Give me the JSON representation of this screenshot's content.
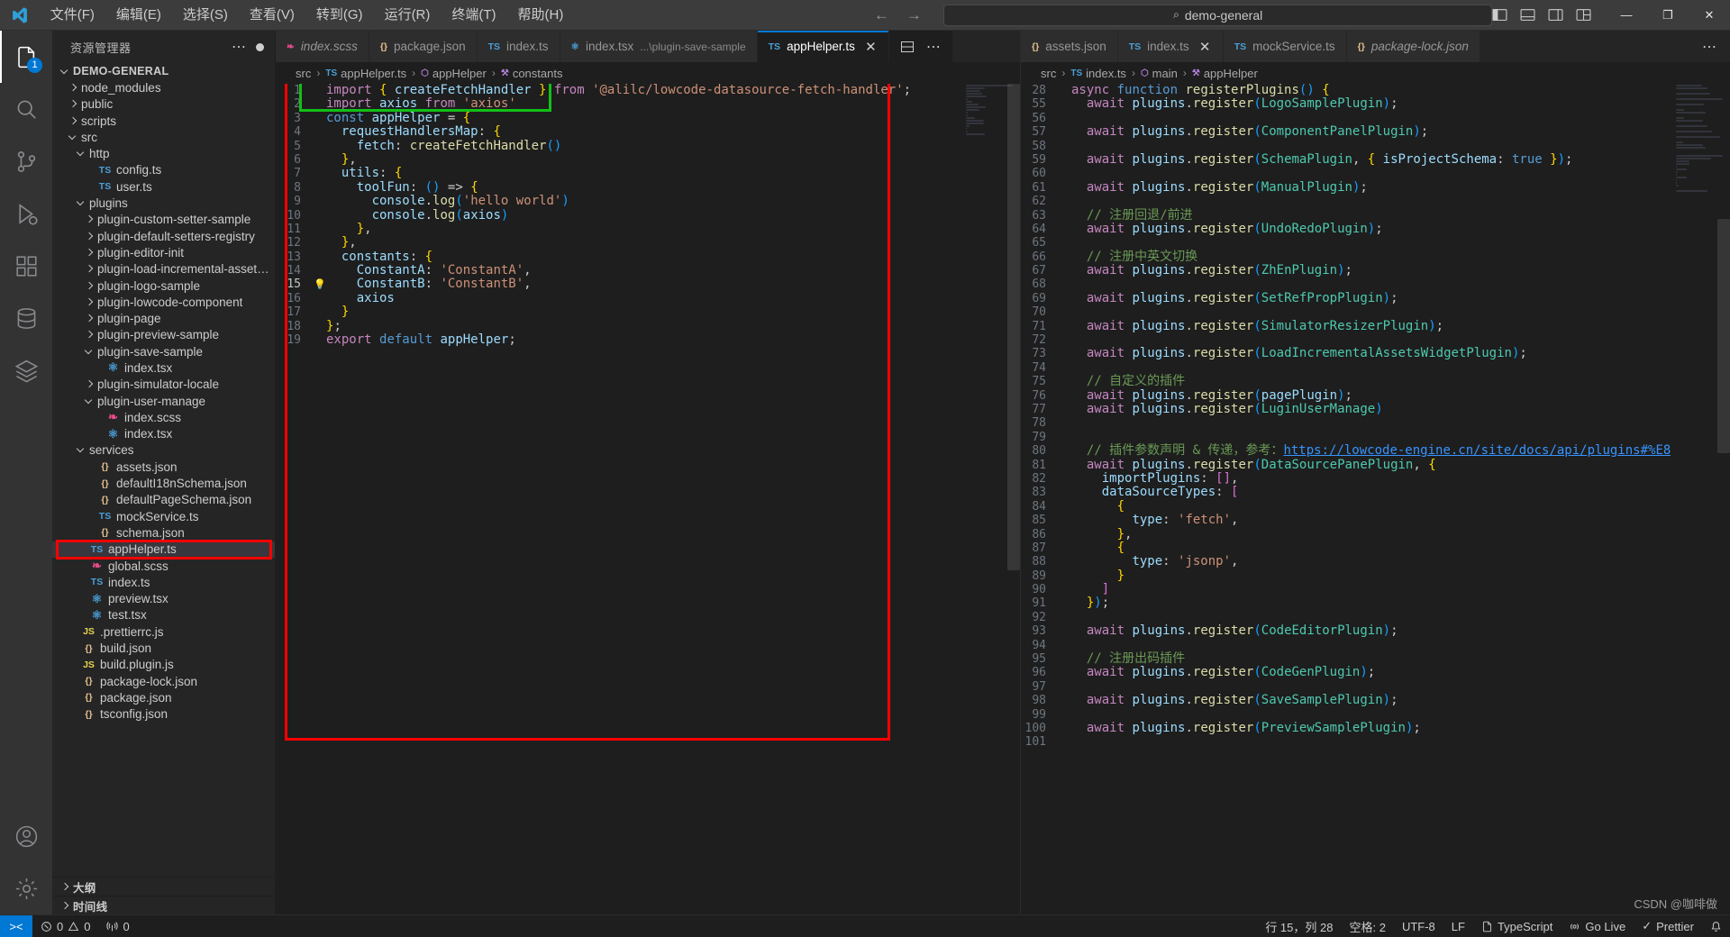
{
  "titlebar": {
    "menus": [
      "文件(F)",
      "编辑(E)",
      "选择(S)",
      "查看(V)",
      "转到(G)",
      "运行(R)",
      "终端(T)",
      "帮助(H)"
    ],
    "back_arrow": "←",
    "forward_arrow": "→",
    "quick_open": "demo-general",
    "search_glyph": "⌕",
    "minimize": "—",
    "maximize": "❐",
    "close": "✕"
  },
  "activitybar": {
    "items": [
      {
        "name": "explorer",
        "badge": ""
      },
      {
        "name": "search",
        "badge": ""
      },
      {
        "name": "source-control",
        "badge": ""
      },
      {
        "name": "run-and-debug",
        "badge": ""
      },
      {
        "name": "extensions",
        "badge": ""
      },
      {
        "name": "database",
        "badge": ""
      },
      {
        "name": "layers",
        "badge": ""
      }
    ],
    "bottom": [
      "accounts",
      "settings"
    ]
  },
  "sidebar": {
    "title": "资源管理器",
    "more_glyph": "⋯",
    "root": "DEMO-GENERAL",
    "sections": [
      "大纲",
      "时间线"
    ],
    "tree": [
      {
        "label": "DEMO-GENERAL",
        "depth": 0,
        "type": "root",
        "state": "open"
      },
      {
        "label": "node_modules",
        "depth": 1,
        "type": "folder",
        "state": "closed"
      },
      {
        "label": "public",
        "depth": 1,
        "type": "folder",
        "state": "closed"
      },
      {
        "label": "scripts",
        "depth": 1,
        "type": "folder",
        "state": "closed"
      },
      {
        "label": "src",
        "depth": 1,
        "type": "folder",
        "state": "open"
      },
      {
        "label": "http",
        "depth": 2,
        "type": "folder",
        "state": "open"
      },
      {
        "label": "config.ts",
        "depth": 3,
        "type": "ts"
      },
      {
        "label": "user.ts",
        "depth": 3,
        "type": "ts"
      },
      {
        "label": "plugins",
        "depth": 2,
        "type": "folder",
        "state": "open"
      },
      {
        "label": "plugin-custom-setter-sample",
        "depth": 3,
        "type": "folder",
        "state": "closed"
      },
      {
        "label": "plugin-default-setters-registry",
        "depth": 3,
        "type": "folder",
        "state": "closed"
      },
      {
        "label": "plugin-editor-init",
        "depth": 3,
        "type": "folder",
        "state": "closed"
      },
      {
        "label": "plugin-load-incremental-assets-w...",
        "depth": 3,
        "type": "folder",
        "state": "closed"
      },
      {
        "label": "plugin-logo-sample",
        "depth": 3,
        "type": "folder",
        "state": "closed"
      },
      {
        "label": "plugin-lowcode-component",
        "depth": 3,
        "type": "folder",
        "state": "closed"
      },
      {
        "label": "plugin-page",
        "depth": 3,
        "type": "folder",
        "state": "closed"
      },
      {
        "label": "plugin-preview-sample",
        "depth": 3,
        "type": "folder",
        "state": "closed"
      },
      {
        "label": "plugin-save-sample",
        "depth": 3,
        "type": "folder",
        "state": "open"
      },
      {
        "label": "index.tsx",
        "depth": 4,
        "type": "tsx"
      },
      {
        "label": "plugin-simulator-locale",
        "depth": 3,
        "type": "folder",
        "state": "closed"
      },
      {
        "label": "plugin-user-manage",
        "depth": 3,
        "type": "folder",
        "state": "open"
      },
      {
        "label": "index.scss",
        "depth": 4,
        "type": "scss"
      },
      {
        "label": "index.tsx",
        "depth": 4,
        "type": "tsx"
      },
      {
        "label": "services",
        "depth": 2,
        "type": "folder",
        "state": "open"
      },
      {
        "label": "assets.json",
        "depth": 3,
        "type": "json"
      },
      {
        "label": "defaultI18nSchema.json",
        "depth": 3,
        "type": "json"
      },
      {
        "label": "defaultPageSchema.json",
        "depth": 3,
        "type": "json"
      },
      {
        "label": "mockService.ts",
        "depth": 3,
        "type": "ts"
      },
      {
        "label": "schema.json",
        "depth": 3,
        "type": "json"
      },
      {
        "label": "appHelper.ts",
        "depth": 2,
        "type": "ts",
        "selected": true,
        "highlight": "red"
      },
      {
        "label": "global.scss",
        "depth": 2,
        "type": "scss"
      },
      {
        "label": "index.ts",
        "depth": 2,
        "type": "ts"
      },
      {
        "label": "preview.tsx",
        "depth": 2,
        "type": "tsx"
      },
      {
        "label": "test.tsx",
        "depth": 2,
        "type": "tsx"
      },
      {
        "label": ".prettierrc.js",
        "depth": 1,
        "type": "js"
      },
      {
        "label": "build.json",
        "depth": 1,
        "type": "json"
      },
      {
        "label": "build.plugin.js",
        "depth": 1,
        "type": "js"
      },
      {
        "label": "package-lock.json",
        "depth": 1,
        "type": "json"
      },
      {
        "label": "package.json",
        "depth": 1,
        "type": "json"
      },
      {
        "label": "tsconfig.json",
        "depth": 1,
        "type": "json"
      }
    ]
  },
  "left_pane": {
    "tabs": [
      {
        "label": "index.scss",
        "icon": "scss",
        "preview": true,
        "active": false,
        "close": false
      },
      {
        "label": "package.json",
        "icon": "json",
        "preview": false,
        "active": false,
        "close": false
      },
      {
        "label": "index.ts",
        "icon": "ts",
        "preview": false,
        "active": false,
        "close": false
      },
      {
        "label": "index.tsx",
        "icon": "tsx",
        "sub": "...\\plugin-save-sample",
        "preview": false,
        "active": false,
        "close": false
      },
      {
        "label": "appHelper.ts",
        "icon": "ts",
        "preview": false,
        "active": true,
        "close": true
      }
    ],
    "breadcrumb": [
      "src",
      "appHelper.ts",
      "appHelper",
      "constants"
    ],
    "lines": [
      {
        "n": 1,
        "text": "import { createFetchHandler } from '@alilc/lowcode-datasource-fetch-handler';"
      },
      {
        "n": 2,
        "text": "import axios from 'axios'"
      },
      {
        "n": 3,
        "text": "const appHelper = {"
      },
      {
        "n": 4,
        "text": "  requestHandlersMap: {"
      },
      {
        "n": 5,
        "text": "    fetch: createFetchHandler()"
      },
      {
        "n": 6,
        "text": "  },"
      },
      {
        "n": 7,
        "text": "  utils: {"
      },
      {
        "n": 8,
        "text": "    toolFun: () => {"
      },
      {
        "n": 9,
        "text": "      console.log('hello world')"
      },
      {
        "n": 10,
        "text": "      console.log(axios)"
      },
      {
        "n": 11,
        "text": "    },"
      },
      {
        "n": 12,
        "text": "  },"
      },
      {
        "n": 13,
        "text": "  constants: {"
      },
      {
        "n": 14,
        "text": "    ConstantA: 'ConstantA',"
      },
      {
        "n": 15,
        "text": "    ConstantB: 'ConstantB',"
      },
      {
        "n": 16,
        "text": "    axios"
      },
      {
        "n": 17,
        "text": "  }"
      },
      {
        "n": 18,
        "text": "};"
      },
      {
        "n": 19,
        "text": "export default appHelper;"
      }
    ],
    "cursor_line": 15,
    "lightbulb_line": 15
  },
  "right_pane": {
    "tabs": [
      {
        "label": "assets.json",
        "icon": "json",
        "preview": false,
        "active": false,
        "close": false
      },
      {
        "label": "index.ts",
        "icon": "ts",
        "preview": false,
        "active": false,
        "close": true
      },
      {
        "label": "mockService.ts",
        "icon": "ts",
        "preview": false,
        "active": false,
        "close": false
      },
      {
        "label": "package-lock.json",
        "icon": "json",
        "preview": true,
        "active": false,
        "close": false
      }
    ],
    "more_glyph": "⋯",
    "breadcrumb": [
      "src",
      "index.ts",
      "main",
      "appHelper"
    ],
    "lines": [
      {
        "n": 28,
        "text": "async function registerPlugins() {"
      },
      {
        "n": 55,
        "text": "  await plugins.register(LogoSamplePlugin);"
      },
      {
        "n": 56,
        "text": ""
      },
      {
        "n": 57,
        "text": "  await plugins.register(ComponentPanelPlugin);"
      },
      {
        "n": 58,
        "text": ""
      },
      {
        "n": 59,
        "text": "  await plugins.register(SchemaPlugin, { isProjectSchema: true });"
      },
      {
        "n": 60,
        "text": ""
      },
      {
        "n": 61,
        "text": "  await plugins.register(ManualPlugin);"
      },
      {
        "n": 62,
        "text": ""
      },
      {
        "n": 63,
        "text": "  // 注册回退/前进"
      },
      {
        "n": 64,
        "text": "  await plugins.register(UndoRedoPlugin);"
      },
      {
        "n": 65,
        "text": ""
      },
      {
        "n": 66,
        "text": "  // 注册中英文切换"
      },
      {
        "n": 67,
        "text": "  await plugins.register(ZhEnPlugin);"
      },
      {
        "n": 68,
        "text": ""
      },
      {
        "n": 69,
        "text": "  await plugins.register(SetRefPropPlugin);"
      },
      {
        "n": 70,
        "text": ""
      },
      {
        "n": 71,
        "text": "  await plugins.register(SimulatorResizerPlugin);"
      },
      {
        "n": 72,
        "text": ""
      },
      {
        "n": 73,
        "text": "  await plugins.register(LoadIncrementalAssetsWidgetPlugin);"
      },
      {
        "n": 74,
        "text": ""
      },
      {
        "n": 75,
        "text": "  // 自定义的插件"
      },
      {
        "n": 76,
        "text": "  await plugins.register(pagePlugin);"
      },
      {
        "n": 77,
        "text": "  await plugins.register(LuginUserManage)"
      },
      {
        "n": 78,
        "text": ""
      },
      {
        "n": 79,
        "text": ""
      },
      {
        "n": 80,
        "text": "  // 插件参数声明 & 传递，参考：https://lowcode-engine.cn/site/docs/api/plugins#%E8"
      },
      {
        "n": 81,
        "text": "  await plugins.register(DataSourcePanePlugin, {"
      },
      {
        "n": 82,
        "text": "    importPlugins: [],"
      },
      {
        "n": 83,
        "text": "    dataSourceTypes: ["
      },
      {
        "n": 84,
        "text": "      {"
      },
      {
        "n": 85,
        "text": "        type: 'fetch',"
      },
      {
        "n": 86,
        "text": "      },"
      },
      {
        "n": 87,
        "text": "      {"
      },
      {
        "n": 88,
        "text": "        type: 'jsonp',"
      },
      {
        "n": 89,
        "text": "      }"
      },
      {
        "n": 90,
        "text": "    ]"
      },
      {
        "n": 91,
        "text": "  });"
      },
      {
        "n": 92,
        "text": ""
      },
      {
        "n": 93,
        "text": "  await plugins.register(CodeEditorPlugin);"
      },
      {
        "n": 94,
        "text": ""
      },
      {
        "n": 95,
        "text": "  // 注册出码插件"
      },
      {
        "n": 96,
        "text": "  await plugins.register(CodeGenPlugin);"
      },
      {
        "n": 97,
        "text": ""
      },
      {
        "n": 98,
        "text": "  await plugins.register(SaveSamplePlugin);"
      },
      {
        "n": 99,
        "text": ""
      },
      {
        "n": 100,
        "text": "  await plugins.register(PreviewSamplePlugin);"
      },
      {
        "n": 101,
        "text": ""
      }
    ]
  },
  "statusbar": {
    "remote_glyph": "><",
    "errors": "0",
    "warnings": "0",
    "ports": "0",
    "cursor": "行 15，列 28",
    "spaces": "空格: 2",
    "encoding": "UTF-8",
    "eol": "LF",
    "language": "TypeScript",
    "golive": "Go Live",
    "prettier": "Prettier",
    "bell": "🔔",
    "smiley": "☺"
  },
  "watermark": "CSDN @咖啡做"
}
